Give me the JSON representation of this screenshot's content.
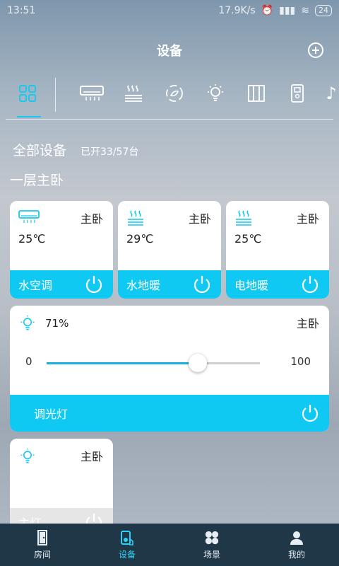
{
  "status": {
    "time": "13:51",
    "speed": "17.9K/s",
    "battery": "24"
  },
  "header": {
    "title": "设备"
  },
  "categories": [
    {
      "name": "all-devices"
    },
    {
      "name": "air-conditioner"
    },
    {
      "name": "floor-heating"
    },
    {
      "name": "fresh-air"
    },
    {
      "name": "light"
    },
    {
      "name": "curtain"
    },
    {
      "name": "door-lock"
    },
    {
      "name": "music"
    }
  ],
  "section": {
    "title": "全部设备",
    "count": "已开33/57台"
  },
  "room_title": "一层主卧",
  "cards": [
    {
      "room": "主卧",
      "temp": "25℃",
      "label": "水空调"
    },
    {
      "room": "主卧",
      "temp": "29℃",
      "label": "水地暖"
    },
    {
      "room": "主卧",
      "temp": "25℃",
      "label": "电地暖"
    }
  ],
  "dimmer": {
    "pct_text": "71%",
    "room": "主卧",
    "min": "0",
    "max": "100",
    "label": "调光灯",
    "level": 0.71
  },
  "light_card": {
    "room": "主卧",
    "label": "主灯"
  },
  "nav": [
    {
      "label": "房间"
    },
    {
      "label": "设备"
    },
    {
      "label": "场景"
    },
    {
      "label": "我的"
    }
  ],
  "colors": {
    "accent": "#10c9f3",
    "nav_bg": "#1f3746"
  }
}
